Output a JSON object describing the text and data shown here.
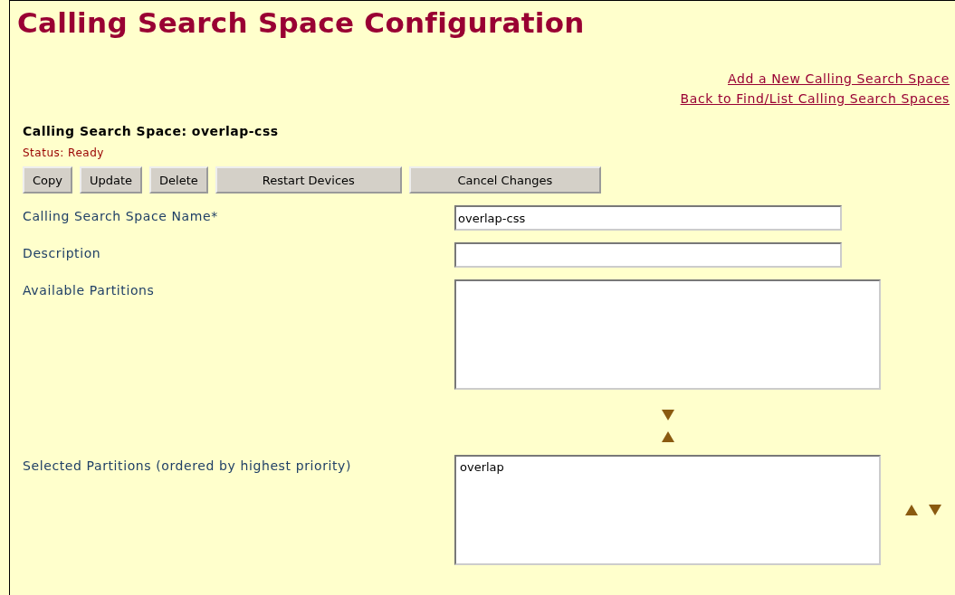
{
  "title": "Calling Search Space Configuration",
  "links": [
    "Add a New Calling Search Space",
    "Back to Find/List Calling Search Spaces"
  ],
  "record_heading": "Calling Search Space:  overlap-css",
  "status": "Status:  Ready",
  "buttons": [
    "Copy",
    "Update",
    "Delete",
    "Restart Devices",
    "Cancel Changes"
  ],
  "fields": [
    {
      "kind": "text",
      "label": "Calling Search Space Name*",
      "value": "overlap-css"
    },
    {
      "kind": "text",
      "label": "Description"
    },
    {
      "kind": "list",
      "label": "Available Partitions"
    },
    {
      "kind": "list",
      "label": "Selected Partitions (ordered by highest priority)",
      "options": [
        "overlap"
      ],
      "reorder": true
    }
  ]
}
